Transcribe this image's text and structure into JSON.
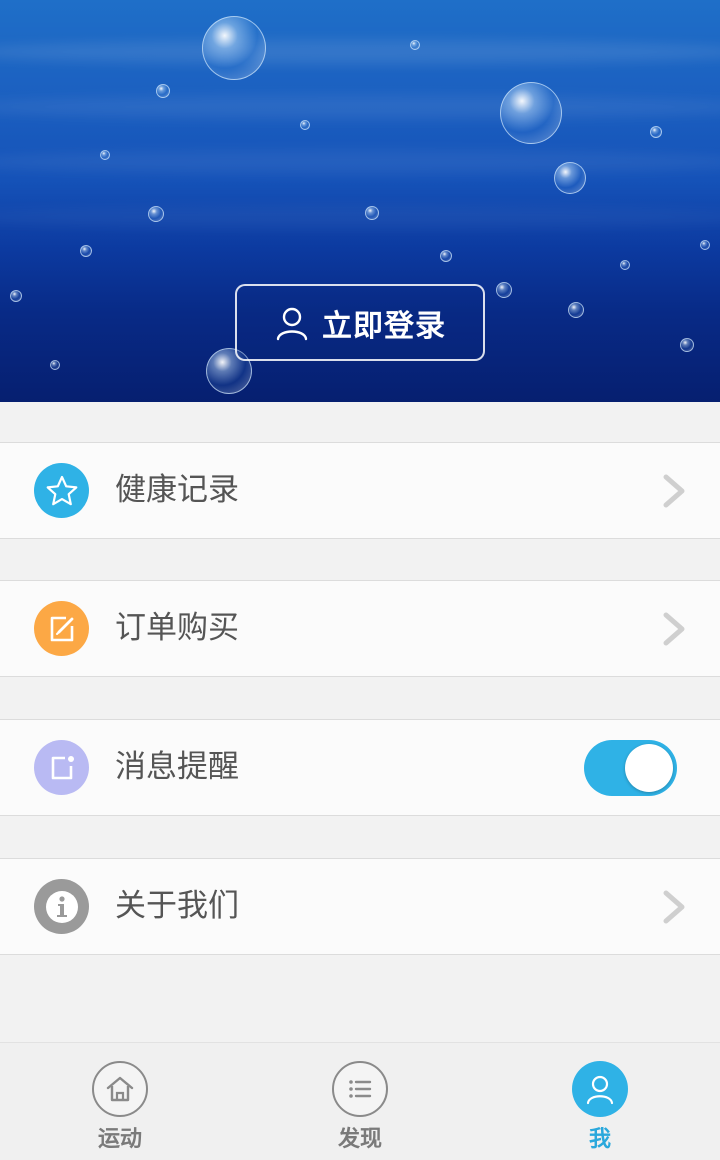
{
  "header": {
    "login_label": "立即登录"
  },
  "menu": [
    {
      "label": "健康记录",
      "icon": "star-icon",
      "icon_color": "#2fb2e6",
      "control": "chevron"
    },
    {
      "label": "订单购买",
      "icon": "edit-icon",
      "icon_color": "#fca845",
      "control": "chevron"
    },
    {
      "label": "消息提醒",
      "icon": "message-icon",
      "icon_color": "#b9baf3",
      "control": "toggle",
      "toggle_on": true
    },
    {
      "label": "关于我们",
      "icon": "info-icon",
      "icon_color": "#9a9a9a",
      "control": "chevron"
    }
  ],
  "bottom_nav": [
    {
      "label": "运动",
      "icon": "home-icon",
      "active": false
    },
    {
      "label": "发现",
      "icon": "list-icon",
      "active": false
    },
    {
      "label": "我",
      "icon": "user-icon",
      "active": true
    }
  ],
  "colors": {
    "accent": "#2fb2e6",
    "toggle_on": "#2fb2e6",
    "nav_active": "#2aa8dc",
    "nav_inactive": "#7a7a7a"
  }
}
